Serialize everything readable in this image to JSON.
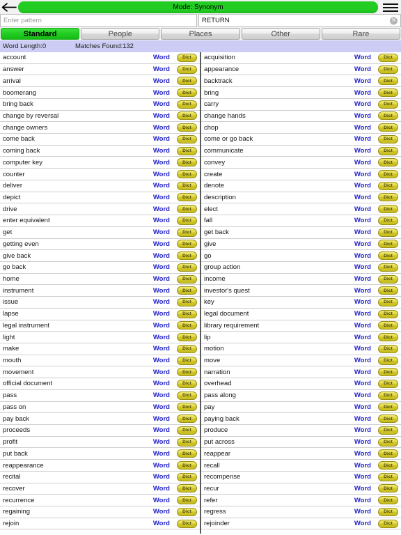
{
  "titlebar": {
    "back_icon": "back-arrow-icon",
    "mode_label": "Mode: Synonym",
    "menu_icon": "hamburger-menu-icon"
  },
  "search": {
    "pattern_placeholder": "Enter pattern",
    "pattern_value": "",
    "keyword_value": "RETURN",
    "clear_icon": "clear-circle-icon",
    "clear_glyph": "✕"
  },
  "tabs": [
    {
      "label": "Standard",
      "active": true
    },
    {
      "label": "People",
      "active": false
    },
    {
      "label": "Places",
      "active": false
    },
    {
      "label": "Other",
      "active": false
    },
    {
      "label": "Rare",
      "active": false
    }
  ],
  "info": {
    "word_length": "Word Length:0",
    "matches_found": "Matches Found:132"
  },
  "row_actions": {
    "word_label": "Word",
    "dict_label": "Dict"
  },
  "colors": {
    "accent_green": "#22cc22",
    "info_bar": "#ccccf5",
    "link_blue": "#2222cc",
    "dict_yellow": "#cdc327"
  },
  "results": {
    "left_column": [
      "account",
      "answer",
      "arrival",
      "boomerang",
      "bring back",
      "change by reversal",
      "change owners",
      "come back",
      "coming back",
      "computer key",
      "counter",
      "deliver",
      "depict",
      "drive",
      "enter equivalent",
      "get",
      "getting even",
      "give back",
      "go back",
      "home",
      "instrument",
      "issue",
      "lapse",
      "legal instrument",
      "light",
      "make",
      "mouth",
      "movement",
      "official document",
      "pass",
      "pass on",
      "pay back",
      "proceeds",
      "profit",
      "put back",
      "reappearance",
      "recital",
      "recover",
      "recurrence",
      "regaining",
      "rejoin"
    ],
    "right_column": [
      "acquisition",
      "appearance",
      "backtrack",
      "bring",
      "carry",
      "change hands",
      "chop",
      "come or go back",
      "communicate",
      "convey",
      "create",
      "denote",
      "description",
      "elect",
      "fall",
      "get back",
      "give",
      "go",
      "group action",
      "income",
      "investor's quest",
      "key",
      "legal document",
      "library requirement",
      "lip",
      "motion",
      "move",
      "narration",
      "overhead",
      "pass along",
      "pay",
      "paying back",
      "produce",
      "put across",
      "reappear",
      "recall",
      "recompense",
      "recur",
      "refer",
      "regress",
      "rejoinder"
    ]
  }
}
